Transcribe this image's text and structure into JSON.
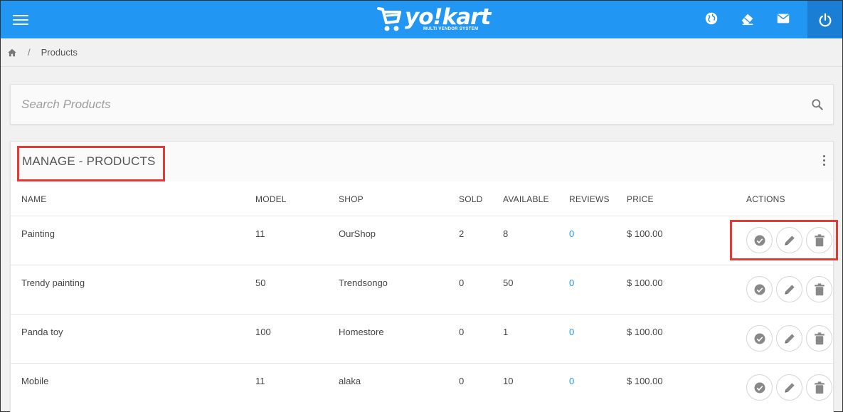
{
  "header": {
    "logo_word": "yo!kart",
    "logo_sub": "MULTI VENDOR SYSTEM",
    "icons": [
      "menu-icon",
      "globe-icon",
      "eraser-icon",
      "mail-icon",
      "power-icon"
    ],
    "brand_color": "#2196f3"
  },
  "breadcrumb": {
    "home_icon": "home-icon",
    "separator": "/",
    "current": "Products"
  },
  "search": {
    "placeholder": "Search Products",
    "value": ""
  },
  "card": {
    "title": "MANAGE - PRODUCTS",
    "columns": [
      "NAME",
      "MODEL",
      "SHOP",
      "SOLD",
      "AVAILABLE",
      "REVIEWS",
      "PRICE",
      "ACTIONS"
    ],
    "rows": [
      {
        "name": "Painting",
        "model": "11",
        "shop": "OurShop",
        "sold": "2",
        "available": "8",
        "reviews": "0",
        "price": "$ 100.00"
      },
      {
        "name": "Trendy painting",
        "model": "50",
        "shop": "Trendsongo",
        "sold": "0",
        "available": "50",
        "reviews": "0",
        "price": "$ 100.00"
      },
      {
        "name": "Panda toy",
        "model": "100",
        "shop": "Homestore",
        "sold": "0",
        "available": "1",
        "reviews": "0",
        "price": "$ 100.00"
      },
      {
        "name": "Mobile",
        "model": "11",
        "shop": "alaka",
        "sold": "0",
        "available": "10",
        "reviews": "0",
        "price": "$ 100.00"
      }
    ],
    "action_icons": [
      "check-circle-icon",
      "pencil-icon",
      "trash-icon"
    ]
  }
}
